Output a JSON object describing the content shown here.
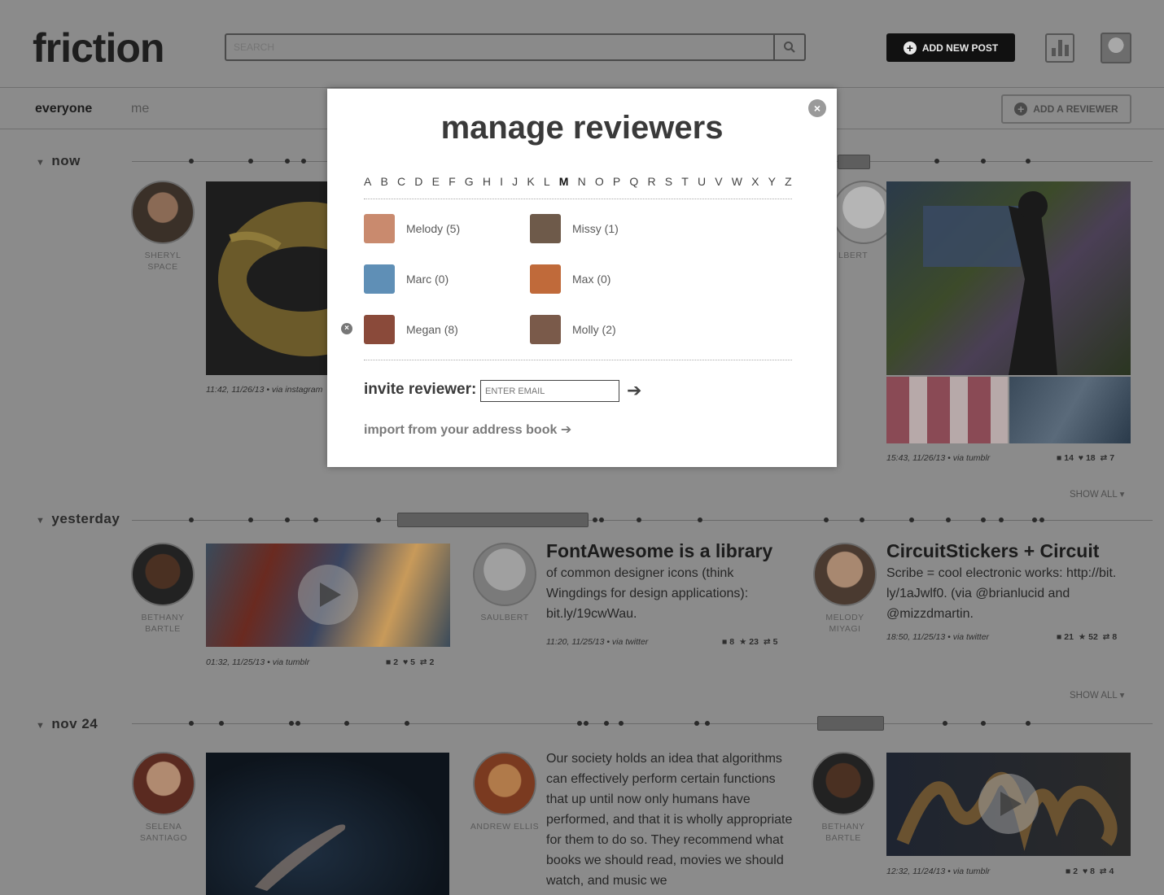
{
  "app": {
    "logo": "friction"
  },
  "header": {
    "search_placeholder": "SEARCH",
    "add_post_label": "ADD NEW POST"
  },
  "tabs": {
    "everyone": "everyone",
    "me": "me"
  },
  "add_reviewer_label": "ADD A REVIEWER",
  "sections": {
    "now": {
      "label": "now",
      "post1": {
        "author": [
          "SHERYL",
          "SPACE"
        ],
        "meta": "11:42, 11/26/13 • via instagram"
      },
      "post2": {
        "author": [
          "SAULBERT"
        ],
        "visible_author_fragment": "LBERT"
      },
      "post3": {
        "meta": "15:43, 11/26/13 • via tumblr",
        "comments": "14",
        "likes": "18",
        "reposts": "7",
        "show_all": "SHOW ALL"
      }
    },
    "yesterday": {
      "label": "yesterday",
      "post1": {
        "author": [
          "BETHANY",
          "BARTLE"
        ],
        "meta": "01:32, 11/25/13 • via tumblr",
        "comments": "2",
        "likes": "5",
        "reposts": "2"
      },
      "post2": {
        "author": [
          "SAULBERT"
        ],
        "title": "FontAwesome is a library",
        "text": "of common designer icons (think Wingdings for design applications): bit.ly/19cwWau.",
        "meta": "11:20, 11/25/13 • via twitter",
        "comments": "8",
        "likes": "23",
        "reposts": "5"
      },
      "post3": {
        "author": [
          "MELODY",
          "MIYAGI"
        ],
        "title": "CircuitStickers + Circuit",
        "text": "Scribe = cool electronic works: http://bit. ly/1aJwlf0. (via @brianlucid and @mizzdmartin.",
        "meta": "18:50, 11/25/13 • via twitter",
        "comments": "21",
        "likes": "52",
        "reposts": "8"
      },
      "show_all": "SHOW ALL"
    },
    "nov24": {
      "label": "nov 24",
      "post1": {
        "author": [
          "SELENA",
          "SANTIAGO"
        ]
      },
      "post2": {
        "author": [
          "ANDREW ELLIS"
        ],
        "text": "Our society holds an idea that algorithms can effectively perform certain functions that up until now only humans have performed, and that it is wholly appropriate for them to do so. They recommend what books we should read, movies we should watch, and music we"
      },
      "post3": {
        "author": [
          "BETHANY",
          "BARTLE"
        ],
        "meta": "12:32, 11/24/13 • via tumblr",
        "comments": "2",
        "likes": "8",
        "reposts": "4"
      }
    }
  },
  "modal": {
    "title": "manage reviewers",
    "letters": [
      "A",
      "B",
      "C",
      "D",
      "E",
      "F",
      "G",
      "H",
      "I",
      "J",
      "K",
      "L",
      "M",
      "N",
      "O",
      "P",
      "Q",
      "R",
      "S",
      "T",
      "U",
      "V",
      "W",
      "X",
      "Y",
      "Z"
    ],
    "active_letter": "M",
    "reviewers": [
      {
        "name": "Melody (5)",
        "color": "#c98a6e"
      },
      {
        "name": "Missy (1)",
        "color": "#6e5a4a"
      },
      {
        "name": "Marc (0)",
        "color": "#5f8fb6"
      },
      {
        "name": "Max (0)",
        "color": "#c06a3a"
      },
      {
        "name": "Megan (8)",
        "color": "#8a4a3a"
      },
      {
        "name": "Molly (2)",
        "color": "#7a5a4a"
      }
    ],
    "invite_label": "invite reviewer:",
    "invite_placeholder": "ENTER EMAIL",
    "import_label": "import from your address book"
  }
}
